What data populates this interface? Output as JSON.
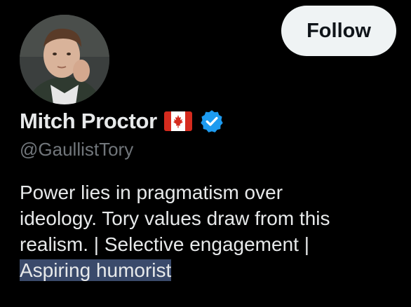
{
  "profile": {
    "display_name": "Mitch Proctor",
    "handle": "@GaullistTory",
    "flag_icon": "canada-flag-icon",
    "verified_icon": "verified-badge-icon",
    "verified_color": "#1d9bf0",
    "bio_lines": [
      "Power lies in pragmatism over",
      "ideology. Tory values draw from this",
      "realism. | Selective engagement |"
    ],
    "bio_highlighted": "Aspiring humorist"
  },
  "actions": {
    "follow_label": "Follow"
  },
  "colors": {
    "background": "#000000",
    "text_primary": "#e7e9ea",
    "text_secondary": "#71767b",
    "selection": "#3a4a6b"
  }
}
